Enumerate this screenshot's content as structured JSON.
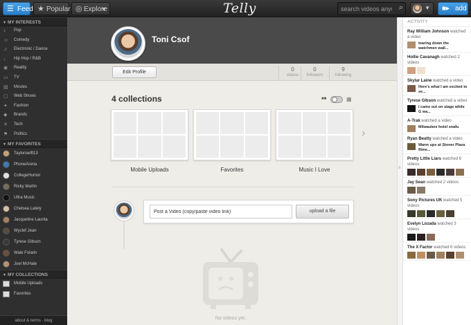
{
  "topbar": {
    "feed_label": "Feed",
    "popular_label": "Popular",
    "explore_label": "Explore",
    "logo": "Telly",
    "search_placeholder": "search videos anywhere",
    "add_label": "add"
  },
  "sidebar": {
    "interests_header": "MY INTERESTS",
    "interests": [
      {
        "label": "Pop",
        "icon": "music-icon"
      },
      {
        "label": "Comedy",
        "icon": "smile-icon"
      },
      {
        "label": "Electronic / Dance",
        "icon": "headphones-icon"
      },
      {
        "label": "Hip Hop / R&B",
        "icon": "microphone-icon"
      },
      {
        "label": "Reality",
        "icon": "camera-icon"
      },
      {
        "label": "TV",
        "icon": "tv-icon"
      },
      {
        "label": "Movies",
        "icon": "film-icon"
      },
      {
        "label": "Web Shows",
        "icon": "monitor-icon"
      },
      {
        "label": "Fashion",
        "icon": "shirt-icon"
      },
      {
        "label": "Brands",
        "icon": "tag-icon"
      },
      {
        "label": "Tech",
        "icon": "tools-icon"
      },
      {
        "label": "Politics",
        "icon": "flag-icon"
      }
    ],
    "favorites_header": "MY FAVORITES",
    "favorites": [
      {
        "label": "Taylorswift13",
        "color": "#c8a070"
      },
      {
        "label": "PhoneArena",
        "color": "#3a7ab8"
      },
      {
        "label": "CollegeHumor",
        "color": "#e0e0e0"
      },
      {
        "label": "Ricky Martin",
        "color": "#7a6a5a"
      },
      {
        "label": "Ultra Music",
        "color": "#111111"
      },
      {
        "label": "Chelsea Lately",
        "color": "#d8c0a0"
      },
      {
        "label": "Jacqueline Laurita",
        "color": "#a88060"
      },
      {
        "label": "Wyclef Jean",
        "color": "#5a4a3a"
      },
      {
        "label": "Tyrese Gibson",
        "color": "#3a3a3a"
      },
      {
        "label": "Wale Folarin",
        "color": "#6a5040"
      },
      {
        "label": "Joel McHale",
        "color": "#b89070"
      }
    ],
    "collections_header": "MY COLLECTIONS",
    "collections": [
      {
        "label": "Mobile Uploads"
      },
      {
        "label": "Favorites"
      }
    ],
    "footer": "about & terms · blog"
  },
  "profile": {
    "name": "Toni Csof",
    "edit_label": "Edit Profile",
    "stats": [
      {
        "value": "0",
        "label": "videos"
      },
      {
        "value": "0",
        "label": "followers"
      },
      {
        "value": "9",
        "label": "following"
      }
    ]
  },
  "main": {
    "collections_title": "4 collections",
    "collections": [
      {
        "label": "Mobile Uploads"
      },
      {
        "label": "Favorites"
      },
      {
        "label": "Music I Love"
      }
    ],
    "post_placeholder": "Post a Video (copy/paste video link)",
    "upload_label": "upload a file",
    "empty_text": "No videos yet."
  },
  "activity": {
    "header": "ACTIVITY",
    "items": [
      {
        "name": "Ray William Johnson",
        "action": "watched a video",
        "caption": "tearing down the watchmen wall...",
        "thumbs": [
          "#b09070"
        ]
      },
      {
        "name": "Hollie Cavanagh",
        "action": "watched 2 videos",
        "caption": "",
        "thumbs": [
          "#d0a080",
          "#f0e0d0"
        ]
      },
      {
        "name": "Skylar Laine",
        "action": "watched a video",
        "caption": "Here's what I am excited to se...",
        "thumbs": [
          "#7a5a4a"
        ]
      },
      {
        "name": "Tyrese Gibson",
        "action": "watched a video",
        "caption": "I came out on stage while G wa...",
        "thumbs": [
          "#111111"
        ]
      },
      {
        "name": "A-Trak",
        "action": "watched a video",
        "caption": "Milwaukee hotel snafu",
        "thumbs": [
          "#a08060"
        ]
      },
      {
        "name": "Ryan Beatty",
        "action": "watched a video",
        "caption": "Warm ups at Stoner Plaza filme...",
        "thumbs": [
          "#6a5a3a"
        ]
      },
      {
        "name": "Pretty Little Liars",
        "action": "watched 6 videos",
        "caption": "",
        "thumbs": [
          "#3a2a2a",
          "#5a4030",
          "#7a6040",
          "#2a2a2a",
          "#4a3a3a",
          "#8a7050"
        ]
      },
      {
        "name": "Jay Sean",
        "action": "watched 2 videos",
        "caption": "",
        "thumbs": [
          "#6a5a4a",
          "#8a7a6a"
        ]
      },
      {
        "name": "Sony Pictures UK",
        "action": "watched 5 videos",
        "caption": "",
        "thumbs": [
          "#3a3a2a",
          "#5a5a3a",
          "#2a2a2a",
          "#6a6040",
          "#4a4030"
        ]
      },
      {
        "name": "Evelyn Lozada",
        "action": "watched 3 videos",
        "caption": "",
        "thumbs": [
          "#1a1a1a",
          "#2a2020",
          "#8a6a5a"
        ]
      },
      {
        "name": "The X Factor",
        "action": "watched 6 videos",
        "caption": "",
        "thumbs": [
          "#8a6a40",
          "#c09060",
          "#6a5a4a",
          "#a08060",
          "#5a4030",
          "#b09070"
        ]
      }
    ]
  },
  "colors": {
    "accent": "#2a7fc8",
    "topbar": "#2a2a2a",
    "sidebar": "#2f2f2f"
  }
}
